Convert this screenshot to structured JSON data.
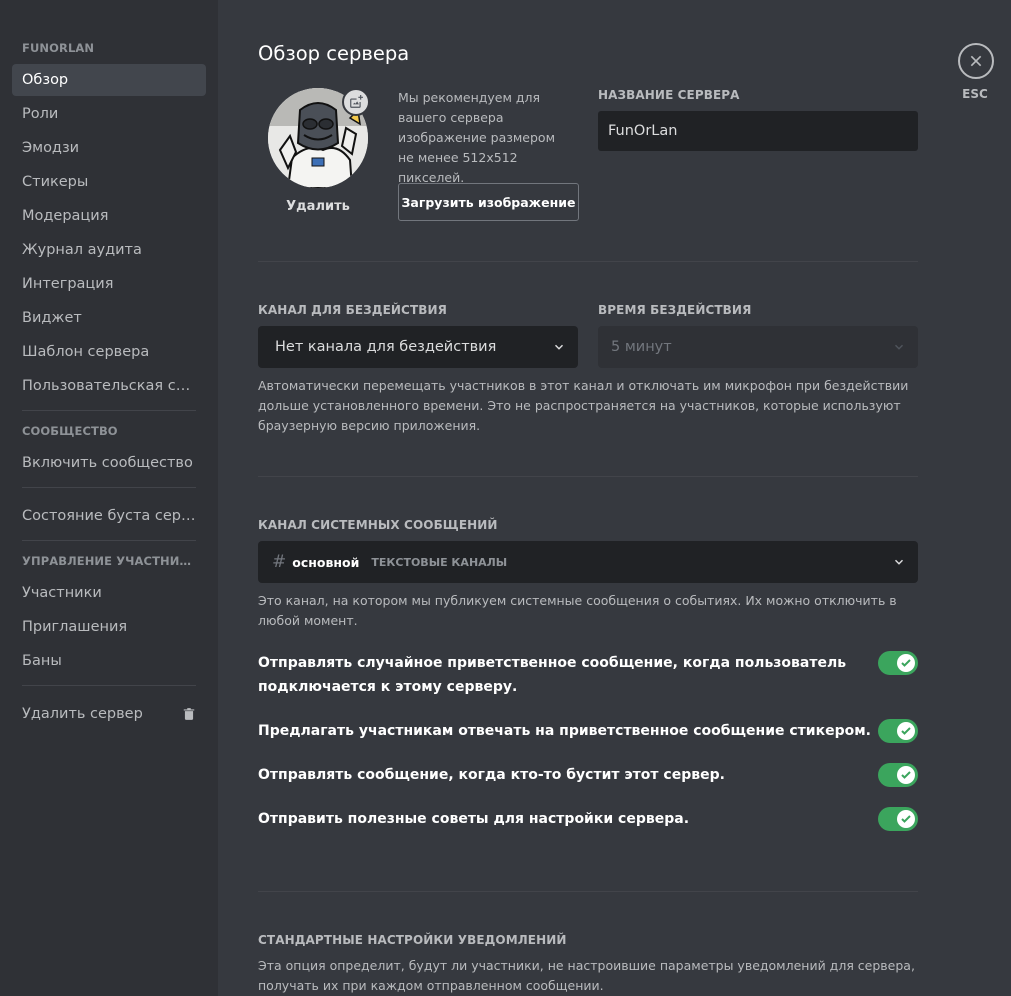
{
  "sidebar": {
    "server_header": "FUNORLAN",
    "items": [
      {
        "label": "Обзор",
        "active": true
      },
      {
        "label": "Роли"
      },
      {
        "label": "Эмодзи"
      },
      {
        "label": "Стикеры"
      },
      {
        "label": "Модерация"
      },
      {
        "label": "Журнал аудита"
      },
      {
        "label": "Интеграция"
      },
      {
        "label": "Виджет"
      },
      {
        "label": "Шаблон сервера"
      },
      {
        "label": "Пользовательская ссы..."
      }
    ],
    "community_header": "СООБЩЕСТВО",
    "community_item": "Включить сообщество",
    "boost_item": "Состояние буста сервера",
    "members_header": "УПРАВЛЕНИЕ УЧАСТНИКА...",
    "members_items": [
      "Участники",
      "Приглашения",
      "Баны"
    ],
    "delete_item": "Удалить сервер"
  },
  "main": {
    "title": "Обзор сервера",
    "avatar_remove": "Удалить",
    "recommend_text": "Мы рекомендуем для вашего сервера изображение размером не менее 512x512 пикселей.",
    "upload_button": "Загрузить изображение",
    "server_name_label": "НАЗВАНИЕ СЕРВЕРА",
    "server_name_value": "FunOrLan",
    "afk_channel_label": "КАНАЛ ДЛЯ БЕЗДЕЙСТВИЯ",
    "afk_channel_value": "Нет канала для бездействия",
    "afk_timeout_label": "ВРЕМЯ БЕЗДЕЙСТВИЯ",
    "afk_timeout_value": "5 минут",
    "afk_help": "Автоматически перемещать участников в этот канал и отключать им микрофон при бездействии дольше установленного времени. Это не распространяется на участников, которые используют браузерную версию приложения.",
    "system_label": "КАНАЛ СИСТЕМНЫХ СООБЩЕНИЙ",
    "system_channel": "основной",
    "system_category": "ТЕКСТОВЫЕ КАНАЛЫ",
    "system_help": "Это канал, на котором мы публикуем системные сообщения о событиях. Их можно отключить в любой момент.",
    "toggles": [
      {
        "label": "Отправлять случайное приветственное сообщение, когда пользователь подключается к этому серверу.",
        "on": true
      },
      {
        "label": "Предлагать участникам отвечать на приветственное сообщение стикером.",
        "on": true
      },
      {
        "label": "Отправлять сообщение, когда кто-то бустит этот сервер.",
        "on": true
      },
      {
        "label": "Отправить полезные советы для настройки сервера.",
        "on": true
      }
    ],
    "notif_label": "СТАНДАРТНЫЕ НАСТРОЙКИ УВЕДОМЛЕНИЙ",
    "notif_help": "Эта опция определит, будут ли участники, не настроившие параметры уведомлений для сервера, получать их при каждом отправленном сообщении."
  },
  "close": {
    "esc_label": "ESC"
  },
  "colors": {
    "toggle_on": "#3ba55d",
    "bg": "#36393f",
    "sidebar": "#2f3136",
    "input": "#202225"
  }
}
